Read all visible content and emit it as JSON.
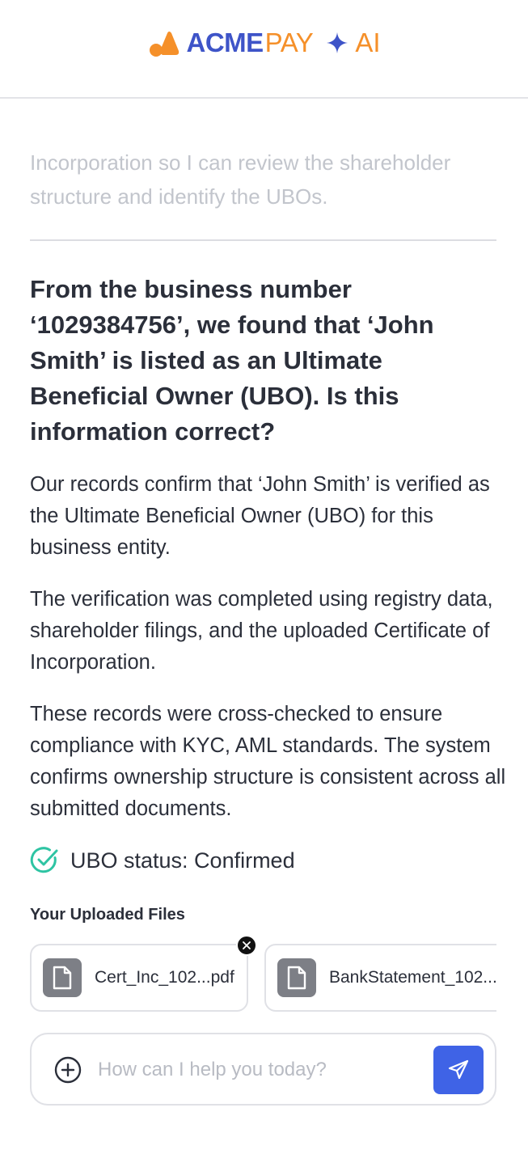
{
  "header": {
    "brand_acme": "ACME",
    "brand_pay": "PAY",
    "brand_ai": "AI"
  },
  "chat": {
    "previous_message_tail": "Incorporation so I can review the shareholder structure and identify the UBOs.",
    "question": "From the business number ‘1029384756’, we found that ‘John Smith’ is listed as an Ultimate Beneficial Owner (UBO). Is this information correct?",
    "paragraphs": [
      "Our records confirm that ‘John Smith’ is verified as the Ultimate Beneficial Owner (UBO) for this business entity.",
      "The verification was completed using registry data, shareholder filings, and the uploaded Certificate of Incorporation.",
      "These records were cross-checked to ensure compliance with KYC, AML standards. The system confirms ownership structure is consistent across all submitted documents."
    ],
    "status_text": "UBO status: Confirmed"
  },
  "files": {
    "title": "Your Uploaded Files",
    "items": [
      {
        "name": "Cert_Inc_102...pdf",
        "icon": "document-icon"
      },
      {
        "name": "BankStatement_102...",
        "icon": "document-icon"
      }
    ]
  },
  "composer": {
    "placeholder": "How can I help you today?",
    "value": ""
  },
  "colors": {
    "brand_blue": "#3e54c8",
    "brand_orange": "#f5902a",
    "send_button": "#3f63e6",
    "status_green": "#2ec4a3"
  }
}
